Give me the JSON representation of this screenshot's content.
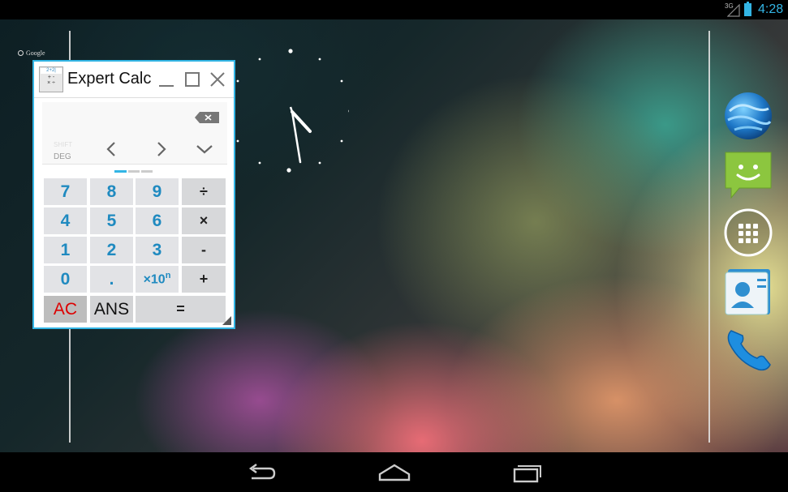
{
  "status_bar": {
    "network_type": "3G",
    "time": "4:28",
    "icons": [
      "signal-icon",
      "battery-charging-icon"
    ],
    "accent_color": "#33b5e5"
  },
  "home": {
    "search_label": "Google",
    "clock_widget": "analog-clock",
    "dock": [
      "browser-globe-icon",
      "messaging-icon",
      "all-apps-icon",
      "contacts-icon",
      "phone-icon"
    ]
  },
  "calc": {
    "title": "Expert Calc",
    "display": {
      "shift_label": "SHIFT",
      "angle_mode": "DEG"
    },
    "keys": {
      "k7": "7",
      "k8": "8",
      "k9": "9",
      "div": "÷",
      "k4": "4",
      "k5": "5",
      "k6": "6",
      "mul": "×",
      "k1": "1",
      "k2": "2",
      "k3": "3",
      "sub": "-",
      "k0": "0",
      "dot": ".",
      "exp": "×10",
      "exp_sup": "n",
      "add": "+",
      "ac": "AC",
      "ans": "ANS",
      "eq": "="
    },
    "accent_color": "#33b5e5"
  },
  "nav_bar": {
    "icons": [
      "back-icon",
      "home-icon",
      "recent-apps-icon"
    ]
  }
}
